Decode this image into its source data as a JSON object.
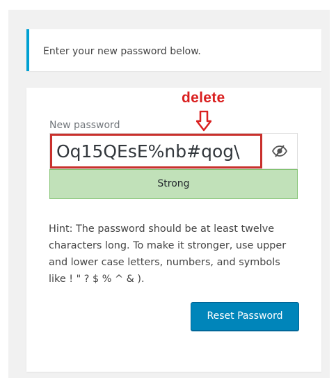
{
  "message": {
    "text": "Enter your new password below."
  },
  "annotation": {
    "text": "delete",
    "color": "#d91f1f"
  },
  "password": {
    "label": "New password",
    "value": "Oq15QEsE%nb#qog\\",
    "toggle_icon": "eye-slash-icon"
  },
  "strength": {
    "label": "Strong",
    "color": "#c1e1b9"
  },
  "hint": {
    "text": "Hint: The password should be at least twelve characters long. To make it stronger, use upper and lower case letters, numbers, and symbols like ! \" ? $ % ^ & )."
  },
  "reset_button": {
    "label": "Reset Password",
    "color": "#0085ba"
  },
  "accent_color": "#00a0d2"
}
